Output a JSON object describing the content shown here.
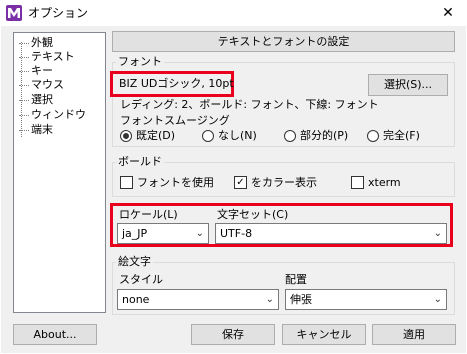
{
  "window": {
    "title": "オプション",
    "close_glyph": "✕"
  },
  "tree": {
    "items": [
      "外観",
      "テキスト",
      "キー",
      "マウス",
      "選択",
      "ウィンドウ",
      "端末"
    ],
    "selected_index": 1
  },
  "panel": {
    "header": "テキストとフォントの設定"
  },
  "font": {
    "group_label": "フォント",
    "current_font": "BIZ UDゴシック, 10pt",
    "select_button": "選択(S)...",
    "rendering_info": "レディング: 2、ボールド: フォント、下線: フォント",
    "smoothing_label": "フォントスムージング",
    "smoothing_options": [
      "既定(D)",
      "なし(N)",
      "部分的(P)",
      "完全(F)"
    ],
    "smoothing_selected": 0
  },
  "bold": {
    "group_label": "ボールド",
    "use_font_label": "フォントを使用",
    "use_font_checked": false,
    "color_label": "をカラー表示",
    "color_checked": true,
    "xterm_label": "xterm",
    "xterm_checked": false
  },
  "locale": {
    "locale_label": "ロケール(L)",
    "locale_value": "ja_JP",
    "charset_label": "文字セット(C)",
    "charset_value": "UTF-8"
  },
  "emoji": {
    "group_label": "絵文字",
    "style_label": "スタイル",
    "style_value": "none",
    "placement_label": "配置",
    "placement_value": "伸張"
  },
  "buttons": {
    "about": "About...",
    "save": "保存",
    "cancel": "キャンセル",
    "apply": "適用"
  },
  "colors": {
    "highlight": "#e8001c",
    "app_icon": "#7b2fa6"
  }
}
